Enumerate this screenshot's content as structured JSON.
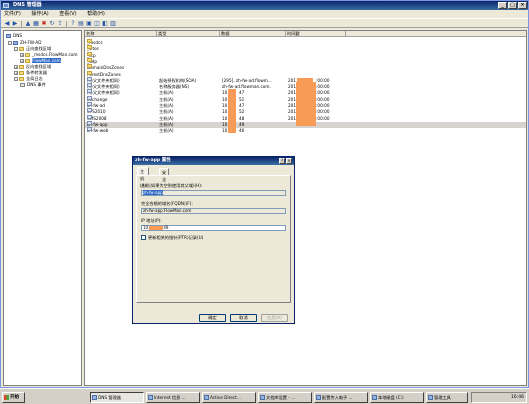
{
  "window": {
    "title": "DNS 管理器",
    "min": "_",
    "max": "□",
    "close": "×"
  },
  "menu": [
    "文件(F)",
    "操作(A)",
    "查看(V)",
    "帮助(H)"
  ],
  "tree": [
    {
      "label": "DNS",
      "icon": "dns-icon"
    },
    {
      "label": "ZH-FW-AD",
      "icon": "server-icon"
    },
    {
      "label": "正向查找区域",
      "icon": "folder-icon"
    },
    {
      "label": "_msdcs.FlowMan.com",
      "icon": "zone-icon"
    },
    {
      "label": "FlowMan.com",
      "icon": "zone-icon",
      "selected": true
    },
    {
      "label": "反向查找区域",
      "icon": "folder-icon"
    },
    {
      "label": "条件转发器",
      "icon": "folder-icon"
    },
    {
      "label": "全局日志",
      "icon": "folder-icon"
    },
    {
      "label": "DNS 事件",
      "icon": "log-icon"
    }
  ],
  "columns": [
    "名称",
    "类型",
    "数据",
    "时间戳"
  ],
  "rows": [
    {
      "name": "_msdcs",
      "type": "",
      "data": "",
      "ts": "",
      "icon": "folder"
    },
    {
      "name": "_sites",
      "type": "",
      "data": "",
      "ts": "",
      "icon": "folder"
    },
    {
      "name": "_tcp",
      "type": "",
      "data": "",
      "ts": "",
      "icon": "folder"
    },
    {
      "name": "_udp",
      "type": "",
      "data": "",
      "ts": "",
      "icon": "folder"
    },
    {
      "name": "DomainDnsZones",
      "type": "",
      "data": "",
      "ts": "",
      "icon": "folder"
    },
    {
      "name": "ForestDnsZones",
      "type": "",
      "data": "",
      "ts": "",
      "icon": "folder"
    },
    {
      "name": "(与父文件夹相同)",
      "type": "起始授权机构(SOA)",
      "data": "[295], zh-fw-ad.flowm...",
      "ts": "201",
      "ts2": ":00:00",
      "icon": "rec"
    },
    {
      "name": "(与父文件夹相同)",
      "type": "名称服务器(NS)",
      "data": "zh-fw-ad.flowman.com.",
      "ts": "201",
      "ts2": ":00:00",
      "icon": "rec"
    },
    {
      "name": "(与父文件夹相同)",
      "type": "主机(A)",
      "data": "10",
      "data2": "47",
      "ts": "201",
      "ts2": ":00:00",
      "icon": "rec"
    },
    {
      "name": "Exchange",
      "type": "主机(A)",
      "data": "10",
      "data2": "51",
      "ts": "201",
      "ts2": ":00:00",
      "icon": "rec"
    },
    {
      "name": "zh-fw-ad",
      "type": "主机(A)",
      "data": "10",
      "data2": "47",
      "ts": "201",
      "ts2": ":00:00",
      "icon": "rec"
    },
    {
      "name": "SPS2010",
      "type": "主机(A)",
      "data": "10",
      "data2": "52",
      "ts": "201",
      "ts2": ":00:00",
      "icon": "rec"
    },
    {
      "name": "SMS2008",
      "type": "主机(A)",
      "data": "10",
      "data2": "48",
      "ts": "201",
      "ts2": ":00:00",
      "icon": "rec"
    },
    {
      "name": "zh-fw-app",
      "type": "主机(A)",
      "data": "10",
      "data2": "49",
      "ts": "",
      "ts2": "",
      "icon": "rec",
      "selected": true
    },
    {
      "name": "zh-fw-web",
      "type": "主机(A)",
      "data": "10",
      "data2": "46",
      "ts": "",
      "ts2": "",
      "icon": "rec"
    }
  ],
  "dialog": {
    "title": "zh-fw-app 属性",
    "help": "?",
    "close": "×",
    "tabs": [
      "主机(A)",
      "安全"
    ],
    "host_label": "主机(如果为空则使用其父域)(H):",
    "host_value": "zh-fw-app",
    "fqdn_label": "完全合格的域名(FQDN)(F):",
    "fqdn_value": "zh-fw-app.FlowMan.com",
    "ip_label": "IP 地址(P):",
    "ip_value_a": "10.",
    "ip_value_b": "49",
    "ptr_label": "更新相关的指针(PTR)记录(U)",
    "ok": "确定",
    "cancel": "取消",
    "apply": "应用(A)"
  },
  "taskbar": {
    "start": "开始",
    "tasks": [
      "DNS 管理器",
      "Internet 信息 ...",
      "Active Direct...",
      "文档库设置 - ...",
      "配置传入电子 ...",
      "本地磁盘 (C:)",
      "管理工具"
    ],
    "clock": "16:46"
  },
  "colors": {
    "redaction": "#f79b57",
    "selection": "#316ac5",
    "titlebar": "#0a246a"
  }
}
